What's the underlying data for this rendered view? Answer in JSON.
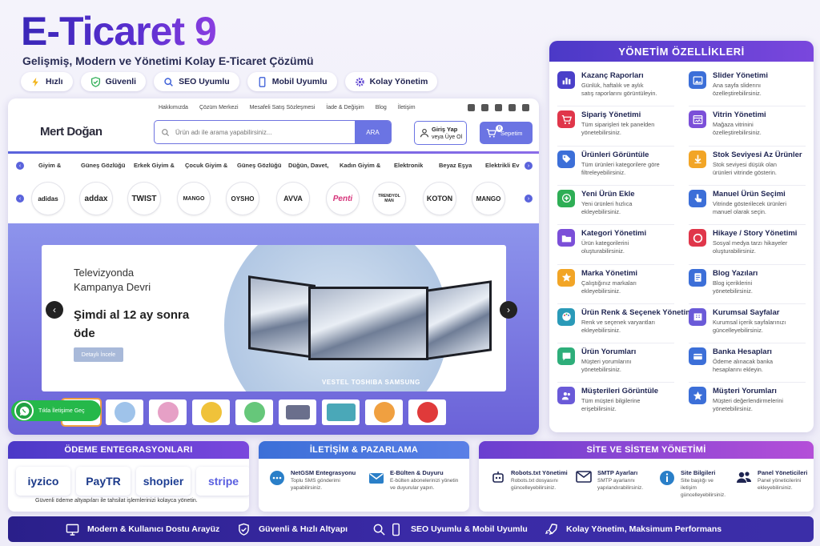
{
  "header": {
    "title": "E-Ticaret 9",
    "subtitle": "Gelişmiş, Modern ve Yönetimi Kolay E-Ticaret Çözümü",
    "pills": [
      "Hızlı",
      "Güvenli",
      "SEO Uyumlu",
      "Mobil Uyumlu",
      "Kolay Yönetim"
    ]
  },
  "site": {
    "topnav": [
      "Hakkımızda",
      "Çözüm Merkezi",
      "Mesafeli Satış Sözleşmesi",
      "İade & Değişim",
      "Blog",
      "İletişim"
    ],
    "logo": "Mert Doğan",
    "search_placeholder": "Ürün adı ile arama yapabilirsiniz...",
    "search_button": "ARA",
    "login_line1": "Giriş Yap",
    "login_line2": "veya Üye Ol",
    "cart_label": "Sepetim",
    "cart_count": "0",
    "categories": [
      "Giyim &",
      "Güneş Gözlüğü",
      "Erkek Giyim &",
      "Çocuk Giyim &",
      "Güneş Gözlüğü",
      "Düğün, Davet,",
      "Kadın Giyim &",
      "Elektronik",
      "Beyaz Eşya",
      "Elektrikli Ev"
    ],
    "brands": [
      "adidas",
      "addax",
      "TWIST",
      "MANGO",
      "OYSHO",
      "AVVA",
      "Penti",
      "TRENDYOL MAN",
      "KOTON",
      "MANGO"
    ],
    "slide": {
      "line1": "Televizyonda",
      "line2": "Kampanya Devri",
      "headline1": "Şimdi al 12 ay sonra",
      "headline2": "öde",
      "button": "Detaylı İncele",
      "tv_brands": "VESTEL  TOSHIBA  SAMSUNG"
    },
    "whatsapp_label": "Tıkla İletişime Geç"
  },
  "admin": {
    "title": "YÖNETİM ÖZELLİKLERİ",
    "left": [
      {
        "title": "Kazanç Raporları",
        "desc": [
          "Günlük, haftalık ve aylık",
          "satış raporlarını görüntüleyin."
        ],
        "icon": "bar-chart-icon",
        "color": "#4a3fc9"
      },
      {
        "title": "Sipariş Yönetimi",
        "desc": [
          "Tüm siparişleri tek panelden",
          "yönetebilirsiniz."
        ],
        "icon": "cart-icon",
        "color": "#e0364a"
      },
      {
        "title": "Ürünleri Görüntüle",
        "desc": [
          "Tüm ürünleri kategorilere göre",
          "filtreleyebilirsiniz."
        ],
        "icon": "tag-icon",
        "color": "#3c6fd8"
      },
      {
        "title": "Yeni Ürün Ekle",
        "desc": [
          "Yeni ürünleri hızlıca",
          "ekleyebilirsiniz."
        ],
        "icon": "plus-icon",
        "color": "#2eae55"
      },
      {
        "title": "Kategori Yönetimi",
        "desc": [
          "Ürün kategorilerini",
          "oluşturabilirsiniz."
        ],
        "icon": "folder-icon",
        "color": "#7b4fd8"
      },
      {
        "title": "Marka Yönetimi",
        "desc": [
          "Çalıştığınız markaları",
          "ekleyebilirsiniz."
        ],
        "icon": "star-icon",
        "color": "#f2a526"
      },
      {
        "title": "Ürün Renk & Seçenek Yönetimi",
        "desc": [
          "Renk ve seçenek varyantları",
          "ekleyebilirsiniz."
        ],
        "icon": "palette-icon",
        "color": "#2a9ab8"
      },
      {
        "title": "Ürün Yorumları",
        "desc": [
          "Müşteri yorumlarını",
          "yönetebilirsiniz."
        ],
        "icon": "comment-icon",
        "color": "#2eae7a"
      },
      {
        "title": "Müşterileri Görüntüle",
        "desc": [
          "Tüm müşteri bilgilerine",
          "erişebilirsiniz."
        ],
        "icon": "users-icon",
        "color": "#6a5ad8"
      }
    ],
    "right": [
      {
        "title": "Slider Yönetimi",
        "desc": [
          "Ana sayfa sliderını",
          "özelleştirebilirsiniz."
        ],
        "icon": "image-icon",
        "color": "#3c6fd8"
      },
      {
        "title": "Vitrin Yönetimi",
        "desc": [
          "Mağaza vitrinini",
          "özelleştirebilirsiniz."
        ],
        "icon": "window-icon",
        "color": "#7b4fd8"
      },
      {
        "title": "Stok Seviyesi Az Ürünler",
        "desc": [
          "Stok seviyesi düşük olan",
          "ürünleri vitrinde gösterin."
        ],
        "icon": "arrow-down-icon",
        "color": "#f2a526"
      },
      {
        "title": "Manuel Ürün Seçimi",
        "desc": [
          "Vitrinde gösterilecek ürünleri",
          "manuel olarak seçin."
        ],
        "icon": "hand-pointer-icon",
        "color": "#3c6fd8"
      },
      {
        "title": "Hikaye / Story Yönetimi",
        "desc": [
          "Sosyal medya tarzı hikayeler",
          "oluşturabilirsiniz."
        ],
        "icon": "story-circle-icon",
        "color": "#e0364a"
      },
      {
        "title": "Blog Yazıları",
        "desc": [
          "Blog içeriklerini",
          "yönetebilirsiniz."
        ],
        "icon": "document-icon",
        "color": "#3c6fd8"
      },
      {
        "title": "Kurumsal Sayfalar",
        "desc": [
          "Kurumsal içerik sayfalarınızı",
          "güncelleyebilirsiniz."
        ],
        "icon": "building-icon",
        "color": "#6a5ad8"
      },
      {
        "title": "Banka Hesapları",
        "desc": [
          "Ödeme alınacak banka",
          "hesaplarını ekleyin."
        ],
        "icon": "bank-card-icon",
        "color": "#3c6fd8"
      },
      {
        "title": "Müşteri Yorumları",
        "desc": [
          "Müşteri değerlendirmelerini",
          "yönetebilirsiniz."
        ],
        "icon": "star-icon",
        "color": "#3c6fd8"
      }
    ]
  },
  "payment": {
    "title": "ÖDEME ENTEGRASYONLARI",
    "logos": [
      "iyzico",
      "PayTR",
      "shopier",
      "stripe"
    ],
    "note": "Güvenli ödeme altyapıları ile tahsilat işlemlerinizi kolayca yönetin."
  },
  "comm": {
    "title": "İLETİŞİM & PAZARLAMA",
    "items": [
      {
        "title": "NetGSM Entegrasyonu",
        "desc": [
          "Toplu SMS gönderimi",
          "yapabilirsiniz."
        ]
      },
      {
        "title": "E-Bülten & Duyuru",
        "desc": [
          "E-bülten abonelerinizi yönetin",
          "ve duyurular yapın."
        ]
      }
    ]
  },
  "system": {
    "title": "SİTE VE SİSTEM YÖNETİMİ",
    "items": [
      {
        "title": "Robots.txt Yönetimi",
        "desc": [
          "Robots.txt dosyasını",
          "güncelleyebilirsiniz."
        ]
      },
      {
        "title": "SMTP Ayarları",
        "desc": [
          "SMTP ayarlarını",
          "yapılandırabilirsiniz."
        ]
      },
      {
        "title": "Site Bilgileri",
        "desc": [
          "Site başlığı ve",
          "iletişim",
          "güncelleyebilirsiniz."
        ]
      },
      {
        "title": "Panel Yöneticileri",
        "desc": [
          "Panel yöneticilerini",
          "ekleyebilirsiniz."
        ]
      }
    ]
  },
  "footer": [
    "Modern & Kullanıcı Dostu Arayüz",
    "Güvenli & Hızlı Altyapı",
    "SEO Uyumlu & Mobil Uyumlu",
    "Kolay Yönetim, Maksimum Performans"
  ]
}
